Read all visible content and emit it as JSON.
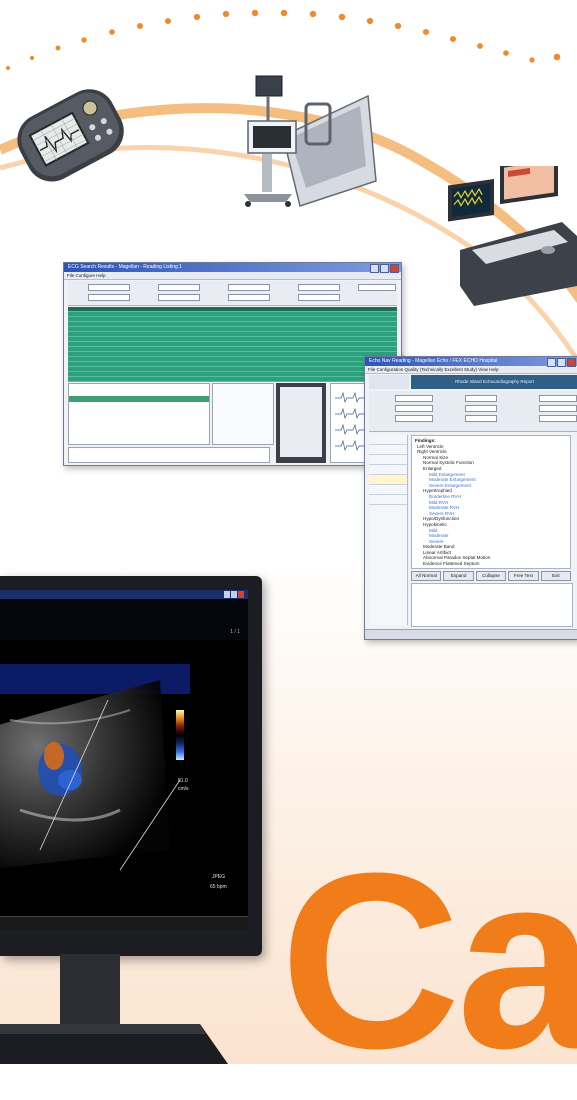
{
  "upper_window": {
    "title": "ECG Search Results - Magellan - Reading Listing 1",
    "menu": "File  Configure  Help"
  },
  "lower_window": {
    "title": "Echo Nav Reading - Magellan Echo / FEX ECHO Hospital",
    "menu": "File  Configuration  Quality (Technically Excellent Study)  View  Help",
    "header": "Rhode Island Echocardiography Report",
    "tree_items": [
      "Findings:",
      "Left Ventricle",
      "Right Ventricle",
      "Normal Size",
      "Normal Systolic Function",
      "Enlarged",
      "Mild Enlargement",
      "Moderate Enlargement",
      "Severe Enlargement",
      "Hypertrophied",
      "Borderline RVH",
      "Mild RVH",
      "Moderate RVH",
      "Severe RVH",
      "Hypo/Dysfunction",
      "Hypokinetic",
      "Mild",
      "Moderate",
      "Severe",
      "Moderate Band",
      "Linear Artifact",
      "Abnormal Paradox Septal Motion",
      "Evidence Flattened Septum"
    ],
    "buttons": [
      "All Normal",
      "Expand",
      "Collapse",
      "Free Text",
      "Exit"
    ]
  },
  "ultrasound": {
    "scale_top": "81.0",
    "scale_unit": "cm/s",
    "image_counter": "1 / 1",
    "heart_rate": "65 bpm",
    "format": "JPEG"
  },
  "brand_letter": "Ca",
  "colors": {
    "accent": "#f07d1a",
    "arc": "#f5b26b",
    "dots": "#f08a2a"
  }
}
